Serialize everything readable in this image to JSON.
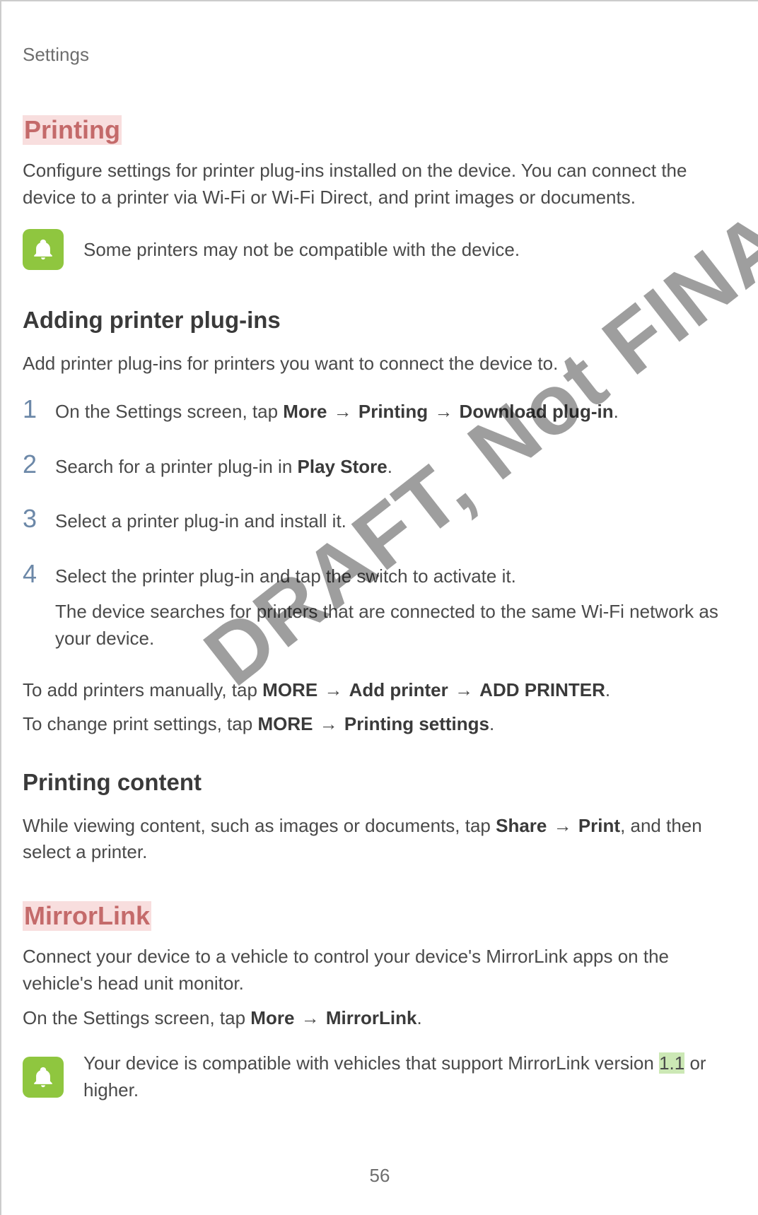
{
  "header": "Settings",
  "page_number": "56",
  "watermark": "DRAFT, Not FINAL",
  "printing": {
    "title": "Printing",
    "intro": "Configure settings for printer plug-ins installed on the device. You can connect the device to a printer via Wi-Fi or Wi-Fi Direct, and print images or documents.",
    "note": "Some printers may not be compatible with the device.",
    "adding": {
      "heading": "Adding printer plug-ins",
      "intro": "Add printer plug-ins for printers you want to connect the device to.",
      "steps": {
        "s1_pre": "On the Settings screen, tap ",
        "s1_more": "More",
        "s1_arrow1": " → ",
        "s1_printing": "Printing",
        "s1_arrow2": " → ",
        "s1_download": "Download plug-in",
        "s1_end": ".",
        "s2_pre": "Search for a printer plug-in in ",
        "s2_play": "Play Store",
        "s2_end": ".",
        "s3": "Select a printer plug-in and install it.",
        "s4_line1": "Select the printer plug-in and tap the switch to activate it.",
        "s4_note": "The device searches for printers that are connected to the same Wi-Fi network as your device."
      },
      "manual_add_pre": "To add printers manually, tap ",
      "manual_add_more": "MORE",
      "manual_add_arrow1": " → ",
      "manual_add_addprinter": "Add printer",
      "manual_add_arrow2": " → ",
      "manual_add_addprinter2": "ADD PRINTER",
      "manual_add_end": ".",
      "change_pre": "To change print settings, tap ",
      "change_more": "MORE",
      "change_arrow": " → ",
      "change_settings": "Printing settings",
      "change_end": "."
    },
    "content": {
      "heading": "Printing content",
      "text_pre": "While viewing content, such as images or documents, tap ",
      "share": "Share",
      "arrow": " → ",
      "print": "Print",
      "text_post": ", and then select a printer."
    }
  },
  "mirrorlink": {
    "title": "MirrorLink",
    "intro": "Connect your device to a vehicle to control your device's MirrorLink apps on the vehicle's head unit monitor.",
    "path_pre": "On the Settings screen, tap ",
    "path_more": "More",
    "path_arrow": " → ",
    "path_mirror": "MirrorLink",
    "path_end": ".",
    "note_pre": "Your device is compatible with vehicles that support MirrorLink version ",
    "note_ver": "1.1",
    "note_post": " or higher."
  }
}
